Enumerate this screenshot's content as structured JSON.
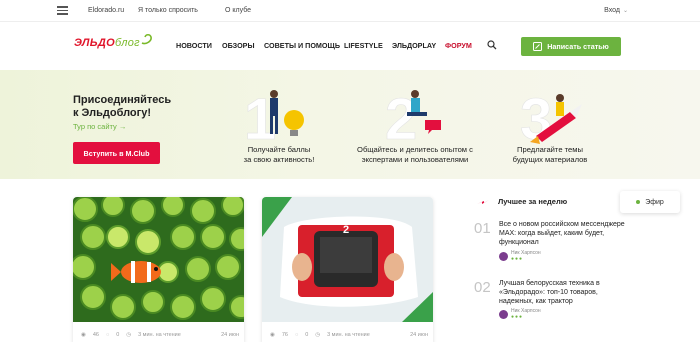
{
  "topbar": {
    "links": [
      "Eldorado.ru",
      "Я только спросить",
      "О клубе"
    ],
    "login": "Вход"
  },
  "header": {
    "logo_main": "ЭЛЬДО",
    "logo_sub": "блог",
    "nav": [
      "НОВОСТИ",
      "ОБЗОРЫ",
      "СОВЕТЫ И ПОМОЩЬ",
      "LIFESTYLE",
      "ЭЛЬДОPLAY",
      "ФОРУМ"
    ],
    "write_button": "Написать статью"
  },
  "banner": {
    "title_line1": "Присоединяйтесь",
    "title_line2": "к Эльдоблогу!",
    "subtitle": "Тур по сайту →",
    "button": "Вступить в M.Club",
    "steps": [
      {
        "line1": "Получайте баллы",
        "line2": "за свою активность!"
      },
      {
        "line1": "Общайтесь и делитесь опытом с",
        "line2": "экспертами и пользователями"
      },
      {
        "line1": "Предлагайте темы",
        "line2": "будущих материалов"
      }
    ]
  },
  "cards": [
    {
      "views": "46",
      "comments": "0",
      "read_time": "3 мин. на чтение",
      "date": "24 июн"
    },
    {
      "views": "76",
      "comments": "0",
      "read_time": "3 мин. на чтение",
      "date": "24 июн"
    }
  ],
  "sidebar": {
    "heading": "Лучшее за неделю",
    "efir": "Эфир",
    "items": [
      {
        "num": "01",
        "text": "Все о новом российском мессенджере MAX: когда выйдет, каким будет, функционал",
        "author": "Ник Харпсон"
      },
      {
        "num": "02",
        "text": "Лучшая белорусская техника в «Эльдорадо»: топ-10 товаров, надежных, как трактор",
        "author": "Ник Харпсон"
      }
    ]
  },
  "colors": {
    "accent_green": "#6cb33f",
    "accent_red": "#e30f3e",
    "brand_red": "#e0142a"
  }
}
